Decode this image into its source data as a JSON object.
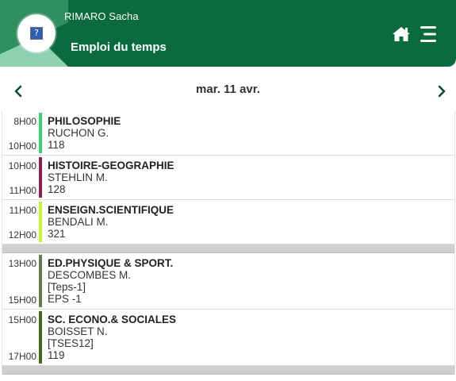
{
  "header": {
    "user_name": "RIMARO Sacha",
    "page_title": "Emploi du temps",
    "avatar_icon": "broken-image-icon",
    "home_icon": "home-icon",
    "menu_icon": "menu-icon"
  },
  "datebar": {
    "date": "mar. 11 avr.",
    "prev_icon": "chevron-left-icon",
    "next_icon": "chevron-right-icon"
  },
  "colors": {
    "header_bg": "#0b6b3f",
    "accent_light": "#8fd0b2"
  },
  "schedule": [
    {
      "start": "8H00",
      "end": "10H00",
      "subject": "PHILOSOPHIE",
      "teacher": "RUCHON G.",
      "group": "",
      "room": "118",
      "color": "#3ecf7a"
    },
    {
      "start": "10H00",
      "end": "11H00",
      "subject": "HISTOIRE-GEOGRAPHIE",
      "teacher": "STEHLIN M.",
      "group": "",
      "room": "128",
      "color": "#8b1f4e"
    },
    {
      "start": "11H00",
      "end": "12H00",
      "subject": "ENSEIGN.SCIENTIFIQUE",
      "teacher": "BENDALI M.",
      "group": "",
      "room": "321",
      "color": "#c9f23a"
    },
    {
      "start": "13H00",
      "end": "15H00",
      "subject": "ED.PHYSIQUE & SPORT.",
      "teacher": "DESCOMBES M.",
      "group": "[Teps-1]",
      "room": "EPS -1",
      "color": "#5f7d4e"
    },
    {
      "start": "15H00",
      "end": "17H00",
      "subject": "SC. ECONO.& SOCIALES",
      "teacher": "BOISSET N.",
      "group": "[TSES12]",
      "room": "119",
      "color": "#3f6b12"
    }
  ]
}
